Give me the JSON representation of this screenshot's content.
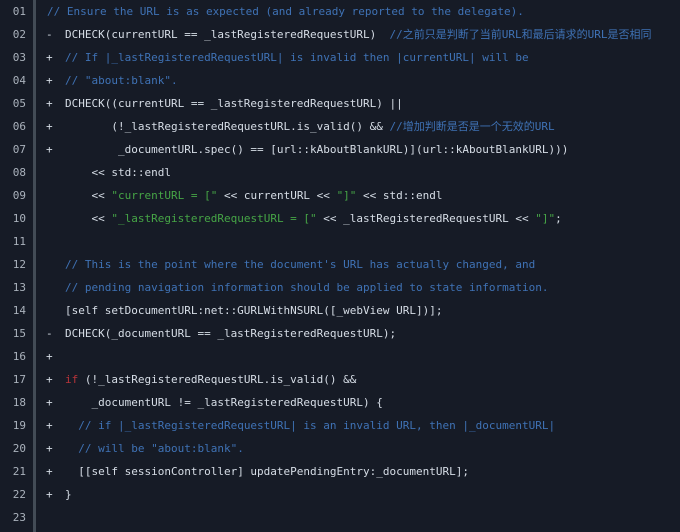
{
  "colors": {
    "background": "#161b26",
    "comment": "#3f72b5",
    "string": "#46a546",
    "keyword": "#b8343a",
    "text": "#d6dde6"
  },
  "lines": [
    {
      "num": "01",
      "marker": "",
      "indent": "",
      "segments": [
        {
          "t": "// Ensure the URL is as expected (and already reported to the delegate).",
          "c": "comment"
        }
      ]
    },
    {
      "num": "02",
      "marker": "-",
      "indent": "",
      "segments": [
        {
          "t": "DCHECK(currentURL == _lastRegisteredRequestURL)  ",
          "c": "plain"
        },
        {
          "t": "//之前只是判断了当前URL和最后请求的URL是否相同",
          "c": "comment"
        }
      ]
    },
    {
      "num": "03",
      "marker": "+",
      "indent": "",
      "segments": [
        {
          "t": "// If |_lastRegisteredRequestURL| is invalid then |currentURL| will be",
          "c": "comment"
        }
      ]
    },
    {
      "num": "04",
      "marker": "+",
      "indent": "",
      "segments": [
        {
          "t": "// \"about:blank\".",
          "c": "comment"
        }
      ]
    },
    {
      "num": "05",
      "marker": "+",
      "indent": "",
      "segments": [
        {
          "t": "DCHECK((currentURL == _lastRegisteredRequestURL) ||",
          "c": "plain"
        }
      ]
    },
    {
      "num": "06",
      "marker": "+",
      "indent": "       ",
      "segments": [
        {
          "t": "(!_lastRegisteredRequestURL.is_valid() && ",
          "c": "plain"
        },
        {
          "t": "//增加判断是否是一个无效的URL",
          "c": "comment"
        }
      ]
    },
    {
      "num": "07",
      "marker": "+",
      "indent": "        ",
      "segments": [
        {
          "t": "_documentURL.spec() == [url::kAboutBlankURL)](url::kAboutBlankURL)))",
          "c": "plain"
        }
      ]
    },
    {
      "num": "08",
      "marker": "",
      "indent": "    ",
      "segments": [
        {
          "t": "<< std::endl",
          "c": "plain"
        }
      ]
    },
    {
      "num": "09",
      "marker": "",
      "indent": "    ",
      "segments": [
        {
          "t": "<< ",
          "c": "plain"
        },
        {
          "t": "\"currentURL = [\"",
          "c": "string"
        },
        {
          "t": " << currentURL << ",
          "c": "plain"
        },
        {
          "t": "\"]\"",
          "c": "string"
        },
        {
          "t": " << std::endl",
          "c": "plain"
        }
      ]
    },
    {
      "num": "10",
      "marker": "",
      "indent": "    ",
      "segments": [
        {
          "t": "<< ",
          "c": "plain"
        },
        {
          "t": "\"_lastRegisteredRequestURL = [\"",
          "c": "string"
        },
        {
          "t": " << _lastRegisteredRequestURL << ",
          "c": "plain"
        },
        {
          "t": "\"]\"",
          "c": "string"
        },
        {
          "t": ";",
          "c": "plain"
        }
      ]
    },
    {
      "num": "11",
      "marker": "",
      "indent": "",
      "segments": []
    },
    {
      "num": "12",
      "marker": "",
      "indent": "",
      "segments": [
        {
          "t": "// This is the point where the document's URL has actually changed, and",
          "c": "comment"
        }
      ]
    },
    {
      "num": "13",
      "marker": "",
      "indent": "",
      "segments": [
        {
          "t": "// pending navigation information should be applied to state information.",
          "c": "comment"
        }
      ]
    },
    {
      "num": "14",
      "marker": "",
      "indent": "",
      "segments": [
        {
          "t": "[self setDocumentURL:net::GURLWithNSURL([_webView URL])];",
          "c": "plain"
        }
      ]
    },
    {
      "num": "15",
      "marker": "-",
      "indent": "",
      "segments": [
        {
          "t": "DCHECK(_documentURL == _lastRegisteredRequestURL);",
          "c": "plain"
        }
      ]
    },
    {
      "num": "16",
      "marker": "+",
      "indent": "",
      "segments": []
    },
    {
      "num": "17",
      "marker": "+",
      "indent": "",
      "segments": [
        {
          "t": "if",
          "c": "keyword"
        },
        {
          "t": " (!_lastRegisteredRequestURL.is_valid() &&",
          "c": "plain"
        }
      ]
    },
    {
      "num": "18",
      "marker": "+",
      "indent": "    ",
      "segments": [
        {
          "t": "_documentURL != _lastRegisteredRequestURL) {",
          "c": "plain"
        }
      ]
    },
    {
      "num": "19",
      "marker": "+",
      "indent": "  ",
      "segments": [
        {
          "t": "// if |_lastRegisteredRequestURL| is an invalid URL, then |_documentURL|",
          "c": "comment"
        }
      ]
    },
    {
      "num": "20",
      "marker": "+",
      "indent": "  ",
      "segments": [
        {
          "t": "// will be \"about:blank\".",
          "c": "comment"
        }
      ]
    },
    {
      "num": "21",
      "marker": "+",
      "indent": "  ",
      "segments": [
        {
          "t": "[[self sessionController] updatePendingEntry:_documentURL];",
          "c": "plain"
        }
      ]
    },
    {
      "num": "22",
      "marker": "+",
      "indent": "",
      "segments": [
        {
          "t": "}",
          "c": "plain"
        }
      ]
    },
    {
      "num": "23",
      "marker": "",
      "indent": "",
      "segments": []
    }
  ]
}
